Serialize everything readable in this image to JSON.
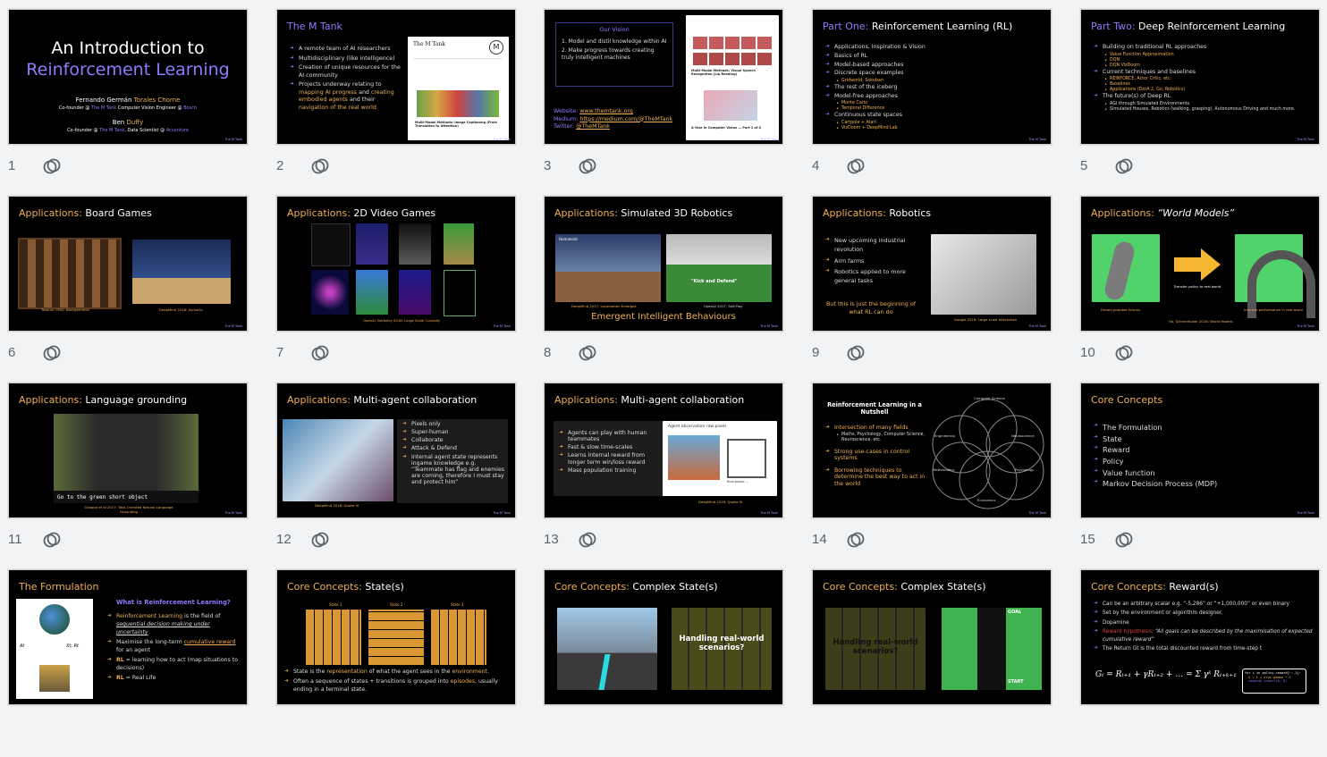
{
  "slides": [
    {
      "number": "1",
      "title": "An Introduction to",
      "title_accent": "Reinforcement Learning",
      "author1": "Fernando Germán",
      "author1_accent": "Torales Chorne",
      "author1_role_a": "Co-founder @",
      "author1_role_b": "The M Tank",
      "author1_role_c": "Computer Vision Engineer @",
      "author1_role_d": "Bosch",
      "author2": "Ben",
      "author2_accent": "Duffy",
      "author2_role_a": "Co-founder @",
      "author2_role_b": "The M Tank",
      "author2_role_c": ", Data Scientist @",
      "author2_role_d": "Accenture",
      "footer": "The M Tank"
    },
    {
      "number": "2",
      "title": "The M Tank",
      "bullets": [
        "A remote team of AI researchers",
        "Multidisciplinary (like intelligence)",
        "Creation of unique resources for the AI community",
        "Projects underway relating to "
      ],
      "bullet4_a": "mapping AI progress",
      "bullet4_b": " and ",
      "bullet4_c": "creating embodied agents",
      "bullet4_d": " and their ",
      "bullet4_e": "navigation of the real world",
      "shot_title": "The M Tank",
      "shot_caption": "Multi-Modal Methods: Image Captioning (From Translation to Attention)",
      "footer": "The M Tank"
    },
    {
      "number": "3",
      "vision_title": "Our Vision",
      "vision_items": [
        "1.   Model and distil knowledge within AI",
        "2.   Make progress towards creating truly intelligent machines"
      ],
      "website_label": "Website:",
      "website": "www.themtank.org",
      "medium_label": "Medium:",
      "medium": "https://medium.com/@TheMTank",
      "twitter_label": "Twitter:",
      "twitter": "@TheMTank",
      "shot_caption1": "Multi-Modal Methods: Visual Speech Recognition (Lip Reading)",
      "shot_caption2": "A Year in Computer Vision — Part 1 of 4",
      "footer": "The M Tank"
    },
    {
      "number": "4",
      "title_a": "Part One:",
      "title_b": "Reinforcement Learning (RL)",
      "items": [
        {
          "t": "Applications, Inspiration & Vision"
        },
        {
          "t": "Basics of RL"
        },
        {
          "t": "Model-based approaches"
        },
        {
          "t": "Discrete space examples"
        },
        {
          "t": "Gridworld, Sokoban",
          "sub": true
        },
        {
          "t": "The rest of the iceberg"
        },
        {
          "t": "Model-free approaches"
        },
        {
          "t": "Monte Carlo",
          "sub": true
        },
        {
          "t": "Temporal Difference",
          "sub": true
        },
        {
          "t": "Continuous state spaces"
        },
        {
          "t": "Cartpole + Atari",
          "sub": true
        },
        {
          "t": "VizDoom + DeepMind Lab",
          "sub": true
        }
      ],
      "footer": "The M Tank"
    },
    {
      "number": "5",
      "title_a": "Part Two:",
      "title_b": "Deep Reinforcement Learning",
      "items": [
        {
          "t": "Building on traditional RL approaches"
        },
        {
          "t": "Value Function Approximation",
          "sub": true
        },
        {
          "t": "DQN",
          "sub": true
        },
        {
          "t": "DQN VizDoom",
          "sub": true
        },
        {
          "t": "Current techniques and baselines"
        },
        {
          "t": "REINFORCE, Actor Critic, etc.",
          "sub": true
        },
        {
          "t": "Baselines",
          "sub": true
        },
        {
          "t": "Applications (DotA 2, Go, Robotics)",
          "sub": true
        },
        {
          "t": "The future(s) of Deep RL"
        },
        {
          "t": "AGI through Simulated Environments",
          "sub": true
        },
        {
          "t": "Simulated Houses, Robotics (walking, grasping), Autonomous Driving and much more.",
          "sub": true
        }
      ],
      "footer": "The M Tank"
    },
    {
      "number": "6",
      "title_a": "Applications:",
      "title_b": "Board Games",
      "cap1": "Tesauro 1992: Backgammon",
      "cap2": "DeepMind 2016: AlphaGo",
      "footer": "The M Tank"
    },
    {
      "number": "7",
      "title_a": "Applications:",
      "title_b": "2D Video Games",
      "cap1": "OpenAI, Berkeley 2018: Large Scale Curiosity",
      "footer": "The M Tank"
    },
    {
      "number": "8",
      "title_a": "Applications:",
      "title_b": "Simulated 3D Robotics",
      "img1_text": "Humanoid",
      "img2_text": "\"Kick and Defend\"",
      "cap1": "DeepMind 2017: Locomotion Emerges",
      "cap2": "OpenAI 2017: Self-Play",
      "subtitle": "Emergent Intelligent Behaviours",
      "footer": "The M Tank"
    },
    {
      "number": "9",
      "title_a": "Applications:",
      "title_b": "Robotics",
      "bullets": [
        "New upcoming industrial revolution",
        "Arm farms",
        "Robotics applied to more general tasks"
      ],
      "note": "But this is just the beginning of what RL can do",
      "cap1": "Google 2016: Large scale Interaction",
      "footer": "The M Tank"
    },
    {
      "number": "10",
      "title_a": "Applications:",
      "title_b": "“World Models”",
      "arrow_text": "Transfer policy to real world",
      "cap1": "Dream possible futures",
      "cap2": "Improve performance in real world",
      "cap3": "Ha, Schmidhuber 2018: World Models",
      "footer": "The M Tank"
    },
    {
      "number": "11",
      "title_a": "Applications:",
      "title_b": "Language grounding",
      "instruction": "Go to the green short object",
      "cap1": "Chaplot et al 2017: Task-Oriented Natural Language Grounding",
      "footer": "The M Tank"
    },
    {
      "number": "12",
      "title_a": "Applications:",
      "title_b": "Multi-agent collaboration",
      "bullets": [
        "Pixels only",
        "Super-human",
        "Collaborate",
        "Attack & Defend",
        "Internal agent state represents ingame knowledge e.g. “Teammate has flag and enemies are coming, therefore I must stay and protect him”"
      ],
      "cap1": "DeepMind 2018: Quake III",
      "footer": "The M Tank"
    },
    {
      "number": "13",
      "title_a": "Applications:",
      "title_b": "Multi-agent collaboration",
      "bullets": [
        "Agents can play with human teammates",
        "Fast & slow time-scales",
        "Learns internal reward from longer term win/loss reward",
        "Mass population training"
      ],
      "img_title": "Agent observation raw pixels",
      "img_label": "Rule-based ...",
      "cap1": "DeepMind 2018: Quake III",
      "footer": "The M Tank"
    },
    {
      "number": "14",
      "title": "Reinforcement Learning in a Nutshell",
      "bullets": [
        "Intersection of many fields",
        "Strong use-cases in control systems",
        "Borrowing techniques to determine the best way to act in the world"
      ],
      "fields": "Maths, Psychology, Computer Science, Neuroscience, etc.",
      "venn": [
        "Computer Science",
        "Engineering",
        "Neuroscience",
        "Mathematics",
        "Psychology",
        "Economics"
      ],
      "footer": "The M Tank"
    },
    {
      "number": "15",
      "title": "Core Concepts",
      "bullets": [
        "The Formulation",
        "State",
        "Reward",
        "Policy",
        "Value function",
        "Markov Decision Process (MDP)"
      ],
      "footer": "The M Tank"
    },
    {
      "number": "",
      "title": "The Formulation",
      "question": "What is Reinforcement Learning?",
      "b1_a": "Reinforcement Learning",
      "b1_b": " is the field of ",
      "b1_c": "sequential decision making under uncertainty",
      "b2_a": "Maximise the long-term ",
      "b2_b": "cumulative reward",
      "b2_c": " for an agent",
      "b3_a": "RL",
      "b3_b": " = learning how to act (map situations to decisions)",
      "b4_a": "RL",
      "b4_b": " = Real Life",
      "env_label": "Environment",
      "agent_label": "Agent (Wall-E)",
      "at": "At",
      "xr": "Xt, Rt",
      "footer": "The M Tank"
    },
    {
      "number": "",
      "title_a": "Core Concepts:",
      "title_b": "State(s)",
      "states": [
        "State 1",
        "State 2",
        "State 3"
      ],
      "b1_a": "State is the ",
      "b1_b": "representation",
      "b1_c": " of what the agent sees in the ",
      "b1_d": "environment.",
      "b2_a": "Often a sequence of states + transitions is grouped into ",
      "b2_b": "episodes",
      "b2_c": ", usually ending in a terminal state.",
      "footer": "The M Tank"
    },
    {
      "number": "",
      "title_a": "Core Concepts:",
      "title_b": "Complex State(s)",
      "panel": "Handling real-world scenarios?",
      "footer": "The M Tank"
    },
    {
      "number": "",
      "title_a": "Core Concepts:",
      "title_b": "Complex State(s)",
      "panel": "Handling real-world scenarios?",
      "goal": "GOAL",
      "start": "START",
      "footer": "The M Tank"
    },
    {
      "number": "",
      "title_a": "Core Concepts:",
      "title_b": "Reward(s)",
      "bullets": [
        "Can be an arbitrary scalar e.g. “-5,286” or “+1,000,000” or even binary",
        "Set by the environment or algorithm designer.",
        "Dopamine"
      ],
      "b4_a": "Reward hypothesis",
      "b4_b": ": “All goals can be described by the maximisation of expected cumulative reward”",
      "b5": "The Return Gt is the total discounted reward from time-step t",
      "formula": "Gₜ = Rₜ₊₁ + γRₜ₊₂ + … = Σ γᵏ Rₜ₊ₖ₊₁",
      "code1": "for i in policy.reward[::-1]:",
      "code2": "G = i + args.gamma * G",
      "code3": "rewards.insert(0, G)",
      "footer": "The M Tank"
    }
  ]
}
